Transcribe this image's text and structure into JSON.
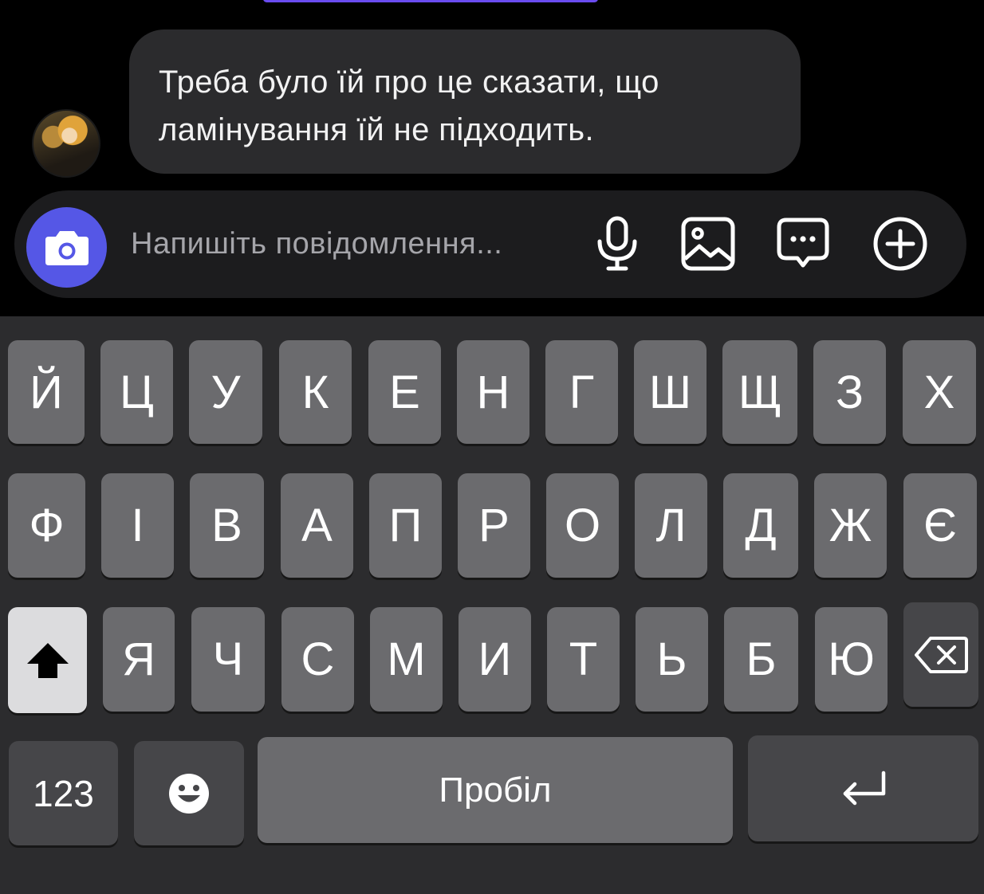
{
  "colors": {
    "background": "#000000",
    "bubble": "#2b2b2d",
    "composer": "#1c1c1e",
    "accent": "#5557e6",
    "keyboard": "#2c2c2e",
    "key": "#6b6b6e",
    "key_dark": "#464649",
    "shift_key": "#dcdcde"
  },
  "chat": {
    "message": {
      "line1": "Треба було їй про це сказати, що",
      "line2": "ламінування їй не підходить."
    },
    "avatar_icon": "user-avatar"
  },
  "composer": {
    "placeholder": "Напишіть повідомлення...",
    "icons": [
      "camera-icon",
      "microphone-icon",
      "image-icon",
      "chat-more-icon",
      "plus-circle-icon"
    ]
  },
  "keyboard": {
    "row1": [
      "Й",
      "Ц",
      "У",
      "К",
      "Е",
      "Н",
      "Г",
      "Ш",
      "Щ",
      "З",
      "Х"
    ],
    "row2": [
      "Ф",
      "І",
      "В",
      "А",
      "П",
      "Р",
      "О",
      "Л",
      "Д",
      "Ж",
      "Є"
    ],
    "row3": [
      "Я",
      "Ч",
      "С",
      "М",
      "И",
      "Т",
      "Ь",
      "Б",
      "Ю"
    ],
    "numbers_label": "123",
    "space_label": "Пробіл",
    "icons": [
      "shift-icon",
      "backspace-icon",
      "emoji-icon",
      "return-icon"
    ]
  }
}
